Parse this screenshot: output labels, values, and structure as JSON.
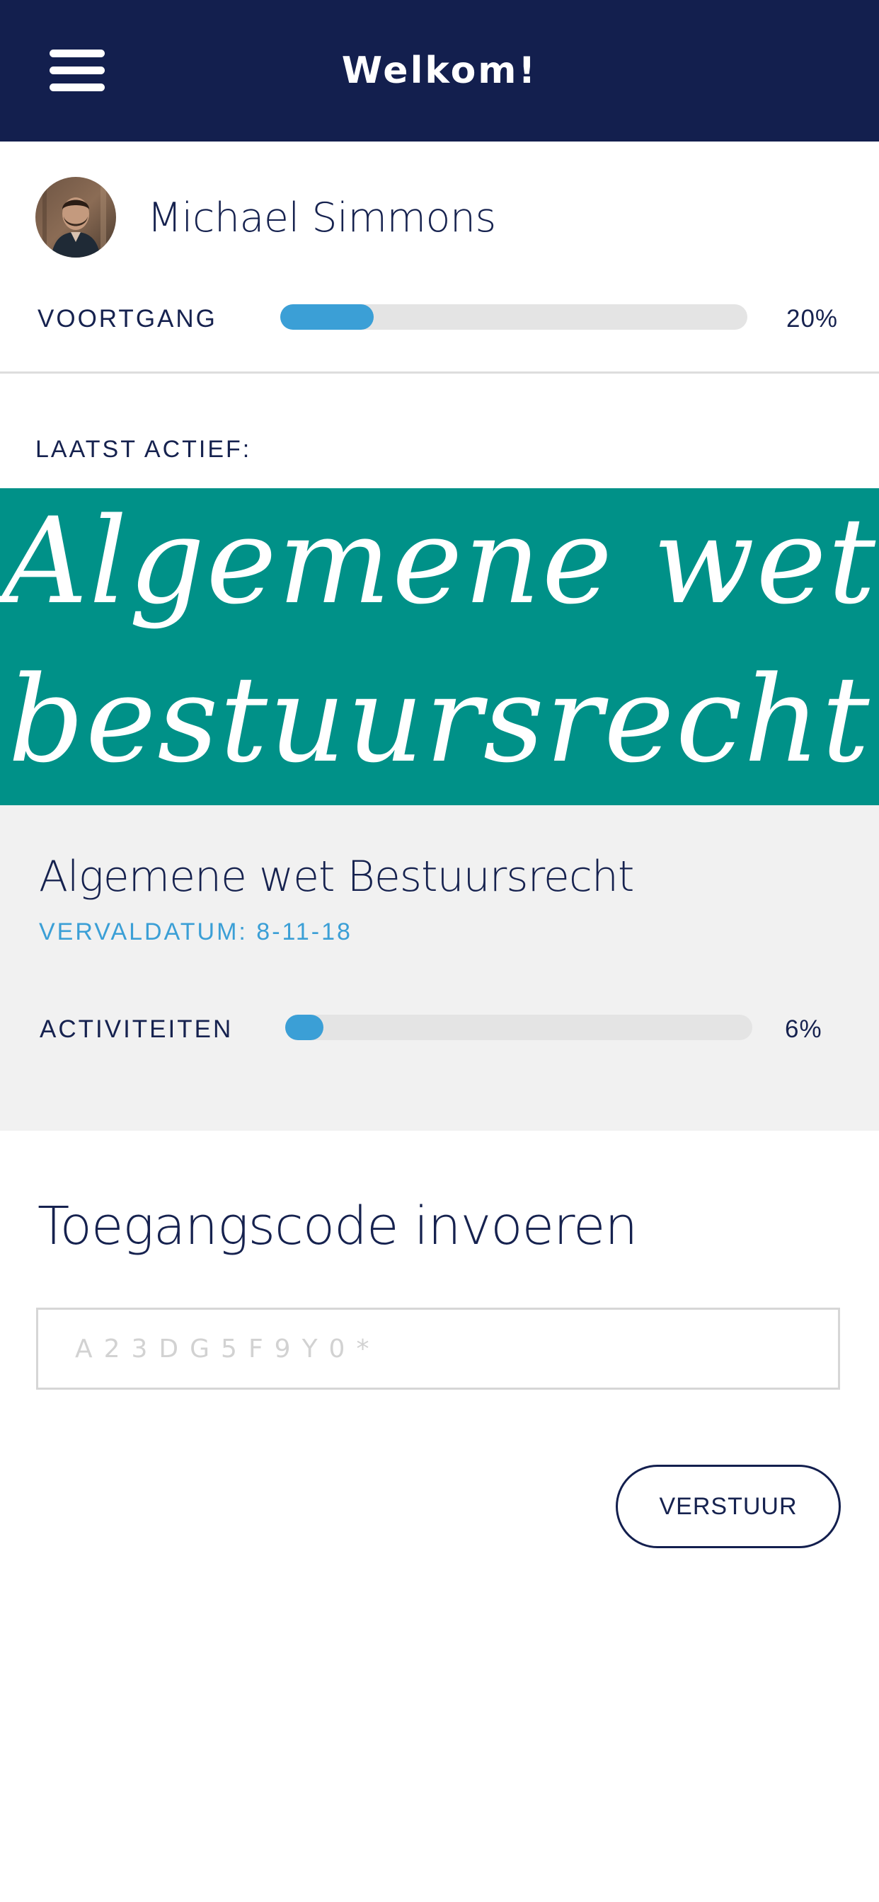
{
  "header": {
    "title": "Welkom!",
    "menu_icon": "hamburger-menu-icon",
    "background_color": "#131f4e"
  },
  "profile": {
    "name": "Michael Simmons",
    "avatar": "avatar-photo"
  },
  "progress": {
    "label": "VOORTGANG",
    "value_text": "20%",
    "fraction": 0.2,
    "color": "#3b9fd6"
  },
  "last_active": {
    "label": "LAATST ACTIEF:",
    "banner_line_1": "Algemene wet",
    "banner_line_2": "bestuursrecht",
    "banner_color": "#009188",
    "course_title": "Algemene wet Bestuursrecht",
    "due_date": "VERVALDATUM: 8-11-18",
    "activities_label": "ACTIVITEITEN",
    "activities_value_text": "6%",
    "activities_fraction": 0.06
  },
  "access_code": {
    "title": "Toegangscode invoeren",
    "placeholder": "A23DG5F9Y0*",
    "value": "",
    "submit_label": "VERSTUUR"
  }
}
